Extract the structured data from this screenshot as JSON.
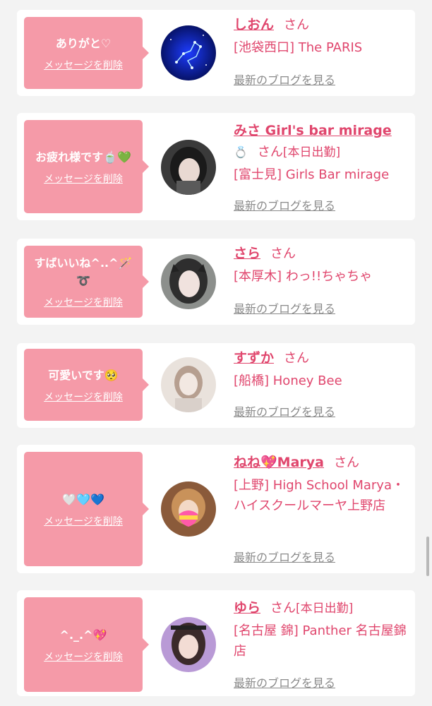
{
  "common": {
    "delete_label": "メッセージを削除",
    "blog_label": "最新のブログを見る",
    "san": "さん"
  },
  "items": [
    {
      "message": "ありがと♡",
      "name": "しおん",
      "status": "",
      "shop": "[池袋西口] The PARIS",
      "avatar_icon": "night-sky-avatar"
    },
    {
      "message": "お疲れ様です🍵💚",
      "name": "みさ Girl's bar mirage",
      "name_suffix_icon": "💍",
      "status": "[本日出勤]",
      "shop": "[富士見] Girls Bar mirage",
      "avatar_icon": "girl-photo-avatar"
    },
    {
      "message": "すばいいね^..^🪄➰",
      "name": "さら",
      "status": "",
      "shop": "[本厚木] わっ!!ちゃちゃ",
      "avatar_icon": "girl-photo-avatar"
    },
    {
      "message": "可愛いです🥺",
      "name": "すずか",
      "status": "",
      "shop": "[船橋] Honey Bee",
      "avatar_icon": "girl-photo-avatar"
    },
    {
      "message": "🤍🩵💙",
      "name": "ねね💖Marya",
      "status": "",
      "shop": "[上野] High School Marya・ハイスクールマーヤ上野店",
      "avatar_icon": "girl-photo-avatar"
    },
    {
      "message": "^._.^💖",
      "name": "ゆら",
      "status": "[本日出勤]",
      "shop": "[名古屋 錦] Panther 名古屋錦店",
      "avatar_icon": "girl-photo-avatar"
    }
  ],
  "colors": {
    "accent_pink": "#e0466d",
    "bubble_pink": "#f59aa8",
    "background": "#f3f3f3"
  }
}
